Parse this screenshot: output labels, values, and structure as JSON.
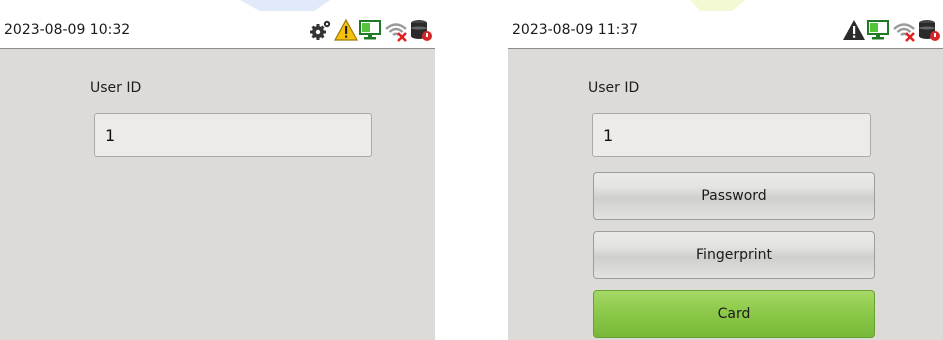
{
  "colors": {
    "accent_green": "#8cc63f",
    "screen_bg": "#dcdbd7",
    "statusbar_bg": "#ffffff"
  },
  "left_screen": {
    "status_time": "2023-08-09 10:32",
    "status_icons": [
      "gear-icon",
      "warning-icon",
      "network-ok-icon",
      "wifi-disconnected-icon",
      "database-icon"
    ],
    "user_id_label": "User ID",
    "user_id_value": "1"
  },
  "right_screen": {
    "status_time": "2023-08-09 11:37",
    "status_icons": [
      "warning-icon",
      "network-ok-icon",
      "wifi-disconnected-icon",
      "database-icon"
    ],
    "user_id_label": "User ID",
    "user_id_value": "1",
    "buttons": [
      {
        "label": "Password",
        "selected": false
      },
      {
        "label": "Fingerprint",
        "selected": false
      },
      {
        "label": "Card",
        "selected": true
      }
    ]
  }
}
